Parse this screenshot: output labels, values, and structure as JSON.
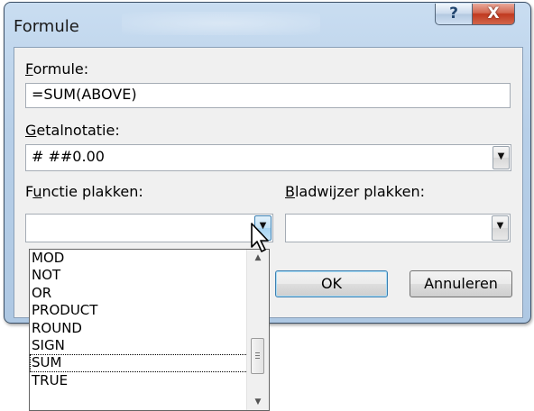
{
  "dialog": {
    "title": "Formule",
    "help_glyph": "?",
    "close_glyph": "X"
  },
  "formula": {
    "label_accel": "F",
    "label_rest": "ormule:",
    "value": "=SUM(ABOVE)"
  },
  "number_format": {
    "label_accel": "G",
    "label_rest": "etalnotatie:",
    "value": "# ##0.00"
  },
  "paste_function": {
    "label_pre": "F",
    "label_accel": "u",
    "label_rest": "nctie plakken:",
    "value": "",
    "dropdown_open": true,
    "items": [
      "MOD",
      "NOT",
      "OR",
      "PRODUCT",
      "ROUND",
      "SIGN",
      "SUM",
      "TRUE"
    ],
    "focused_item": "SUM"
  },
  "paste_bookmark": {
    "label_accel": "B",
    "label_rest": "ladwijzer plakken:",
    "value": ""
  },
  "buttons": {
    "ok": "OK",
    "cancel": "Annuleren"
  },
  "icons": {
    "dropdown_arrow": "▼",
    "scroll_up": "▲",
    "scroll_down": "▼"
  },
  "colors": {
    "frame": "#b7cfe8",
    "close_button": "#c0391f",
    "client": "#f0f0f0"
  }
}
